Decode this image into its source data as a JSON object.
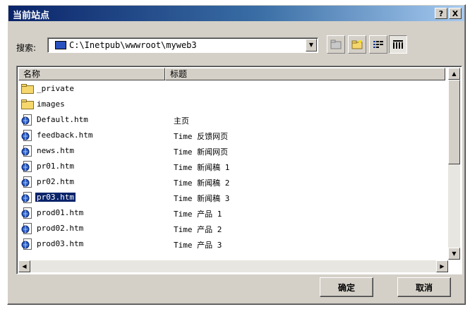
{
  "window": {
    "title": "当前站点",
    "help_label": "?",
    "close_label": "X"
  },
  "lookin": {
    "label": "搜索:",
    "path": "C:\\Inetpub\\wwwroot\\myweb3"
  },
  "columns": {
    "name": "名称",
    "title": "标题"
  },
  "files": [
    {
      "name": "_private",
      "title": "",
      "type": "folder"
    },
    {
      "name": "images",
      "title": "",
      "type": "folder"
    },
    {
      "name": "Default.htm",
      "title": "主页",
      "type": "page"
    },
    {
      "name": "feedback.htm",
      "title": "Time 反馈网页",
      "type": "page"
    },
    {
      "name": "news.htm",
      "title": "Time 新闻网页",
      "type": "page"
    },
    {
      "name": "pr01.htm",
      "title": "Time 新闻稿 1",
      "type": "page"
    },
    {
      "name": "pr02.htm",
      "title": "Time 新闻稿 2",
      "type": "page"
    },
    {
      "name": "pr03.htm",
      "title": "Time 新闻稿 3",
      "type": "page",
      "selected": true
    },
    {
      "name": "prod01.htm",
      "title": "Time 产品 1",
      "type": "page"
    },
    {
      "name": "prod02.htm",
      "title": "Time 产品 2",
      "type": "page"
    },
    {
      "name": "prod03.htm",
      "title": "Time 产品 3",
      "type": "page"
    }
  ],
  "buttons": {
    "ok": "确定",
    "cancel": "取消"
  },
  "colors": {
    "titlebar": "#0a246a",
    "selection": "#0a246a",
    "face": "#d4d0c8"
  }
}
